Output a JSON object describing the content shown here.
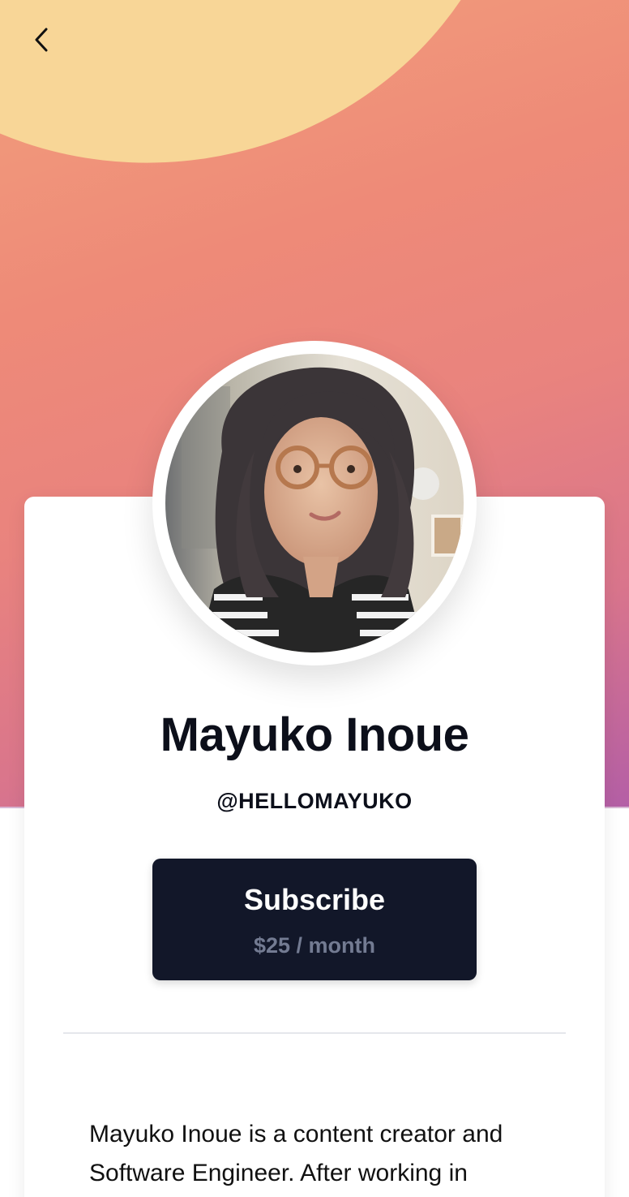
{
  "nav": {
    "back_label": "Back"
  },
  "profile": {
    "name": "Mayuko Inoue",
    "handle": "@HELLOMAYUKO",
    "avatar_alt": "Profile photo of Mayuko Inoue"
  },
  "subscribe": {
    "label": "Subscribe",
    "price": "$25 / month"
  },
  "bio": {
    "text": "Mayuko Inoue is a content creator and Software Engineer. After working in"
  },
  "colors": {
    "hero_gradient": [
      "#f2a07c",
      "#e9837e",
      "#b45fa6"
    ],
    "hero_swoosh": "#f8d697",
    "button_bg": "#121729",
    "button_text": "#ffffff",
    "button_subtext": "#737b92",
    "text_primary": "#0c0f1a"
  },
  "icons": {
    "back": "chevron-left-icon"
  }
}
